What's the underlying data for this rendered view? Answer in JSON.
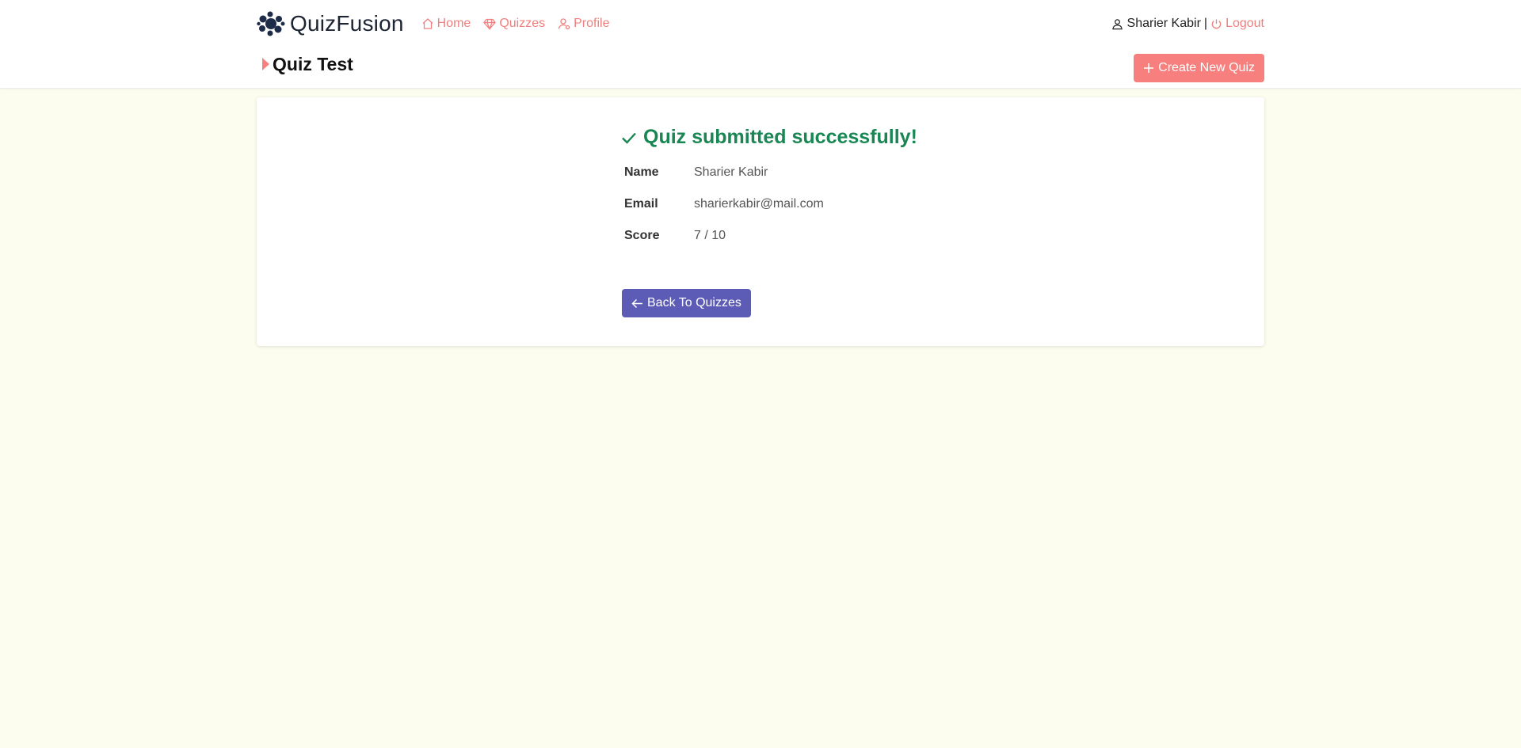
{
  "app": {
    "brand": "QuizFusion",
    "logo_icon": "dots-cluster-logo-icon",
    "accent_color": "#f77f7d"
  },
  "nav": {
    "items": [
      {
        "label": "Home",
        "icon": "home-icon"
      },
      {
        "label": "Quizzes",
        "icon": "diamond-icon"
      },
      {
        "label": "Profile",
        "icon": "person-icon"
      }
    ]
  },
  "user": {
    "name": "Sharier Kabir",
    "separator": "|",
    "logout_label": "Logout"
  },
  "page": {
    "title": "Quiz Test",
    "create_label": "Create New Quiz"
  },
  "result": {
    "message": "Quiz submitted successfully!",
    "success_color": "#198754",
    "rows": [
      {
        "label": "Name",
        "value": "Sharier Kabir"
      },
      {
        "label": "Email",
        "value": "sharierkabir@mail.com"
      },
      {
        "label": "Score",
        "value": "7 / 10"
      }
    ],
    "back_label": "Back To Quizzes",
    "back_color": "#5c5cb6"
  }
}
